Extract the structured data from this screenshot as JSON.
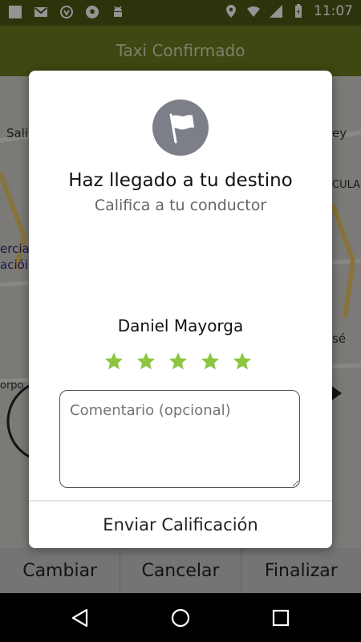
{
  "status_bar": {
    "time": "11:07",
    "left_icons": [
      "square-notification-icon",
      "gmail-icon",
      "vpn-badge-icon",
      "soccer-ball-icon",
      "android-icon"
    ],
    "right_icons": [
      "location-icon",
      "wifi-icon",
      "signal-icon",
      "battery-charging-icon"
    ]
  },
  "app_bar": {
    "title": "Taxi Confirmado"
  },
  "map": {
    "labels": [
      "Sali",
      "ey",
      "CULA",
      "ercia",
      "aciói",
      "sé",
      "orpo"
    ]
  },
  "actions": {
    "change_label": "Cambiar",
    "cancel_label": "Cancelar",
    "finish_label": "Finalizar"
  },
  "dialog": {
    "icon": "flag-icon",
    "title": "Haz llegado a tu destino",
    "subtitle": "Califica a tu conductor",
    "driver_name": "Daniel Mayorga",
    "rating": {
      "value": 5,
      "max": 5,
      "color": "#8cc63f"
    },
    "comment_placeholder": "Comentario (opcional)",
    "submit_label": "Enviar Calificación"
  },
  "colors": {
    "app_bar": "#6b7c1f",
    "status_bar": "#4a5a14",
    "star": "#8cc63f"
  }
}
